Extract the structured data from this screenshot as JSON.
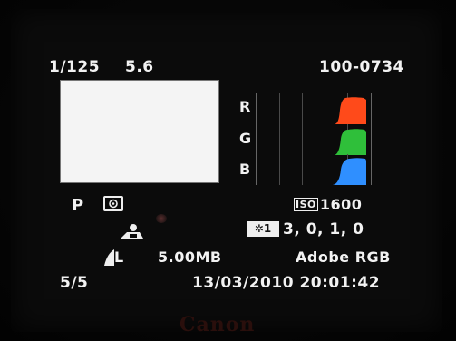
{
  "header": {
    "shutter": "1/125",
    "aperture": "5.6",
    "file_number": "100-0734"
  },
  "histogram": {
    "labels": [
      "R",
      "G",
      "B"
    ],
    "colors": {
      "red": "#ff4a1a",
      "green": "#2fbf3a",
      "blue": "#2f8fff"
    }
  },
  "settings": {
    "mode": "P",
    "metering_icon": "evaluative-metering-icon",
    "iso_label": "ISO",
    "iso_value": "1600",
    "white_balance_icon": "shade-wb-icon",
    "picture_style_label": "1",
    "picture_style_values": "3,  0,  1,  0",
    "quality_icon": "large-fine-quality-icon",
    "quality_label": "L",
    "file_size": "5.00MB",
    "color_space": "Adobe RGB"
  },
  "footer": {
    "image_count": "5/5",
    "datetime": "13/03/2010  20:01:42"
  },
  "brand": "Canon"
}
